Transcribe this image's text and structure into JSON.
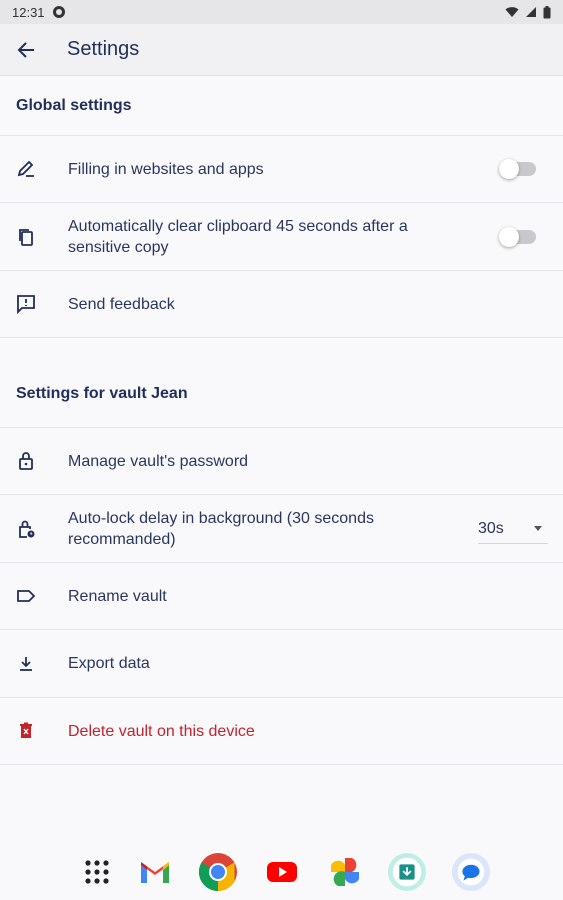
{
  "status_bar": {
    "time": "12:31"
  },
  "app_bar": {
    "title": "Settings"
  },
  "global_settings": {
    "header": "Global settings",
    "items": [
      {
        "label": "Filling in websites and apps",
        "icon": "autofill-pen-icon",
        "toggle_on": false
      },
      {
        "label": "Automatically clear clipboard 45 seconds after a sensitive copy",
        "icon": "clipboard-copy-icon",
        "toggle_on": false
      },
      {
        "label": "Send feedback",
        "icon": "feedback-icon"
      }
    ]
  },
  "vault_settings": {
    "header": "Settings for vault Jean",
    "items": [
      {
        "label": "Manage vault's password",
        "icon": "lock-icon"
      },
      {
        "label": "Auto-lock delay in background (30 seconds recommanded)",
        "icon": "lock-clock-icon",
        "dropdown_value": "30s"
      },
      {
        "label": "Rename vault",
        "icon": "label-icon"
      },
      {
        "label": "Export data",
        "icon": "download-icon"
      },
      {
        "label": "Delete vault on this device",
        "icon": "trash-icon",
        "color": "#c4232b"
      }
    ]
  },
  "dock": {
    "apps": [
      "app-drawer",
      "gmail",
      "chrome",
      "youtube",
      "photos",
      "vault-app",
      "messages"
    ]
  },
  "colors": {
    "primary_text": "#1f2f5a",
    "danger": "#c4232b",
    "toggle_off": "#c9c9cd"
  }
}
